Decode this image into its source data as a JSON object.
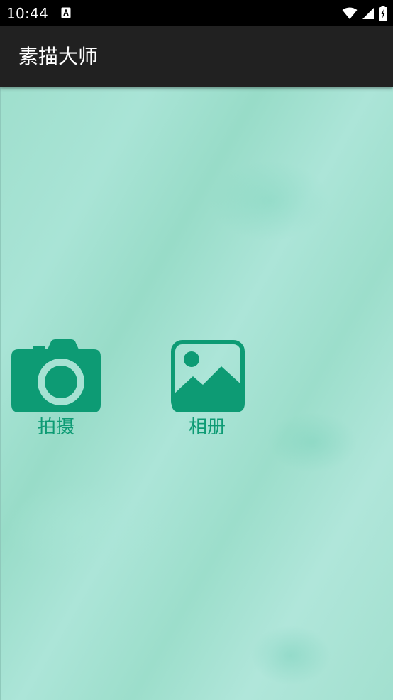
{
  "status_bar": {
    "time": "10:44",
    "icons": [
      "text-notification-icon",
      "wifi-icon",
      "cellular-signal-icon",
      "battery-charging-icon"
    ]
  },
  "app_bar": {
    "title": "素描大师"
  },
  "actions": {
    "camera": {
      "label": "拍摄",
      "icon": "camera-icon"
    },
    "album": {
      "label": "相册",
      "icon": "image-gallery-icon"
    }
  },
  "colors": {
    "status_bar_bg": "#000000",
    "app_bar_bg": "#212121",
    "content_bg": "#a6e2d3",
    "accent": "#0d9b74"
  }
}
